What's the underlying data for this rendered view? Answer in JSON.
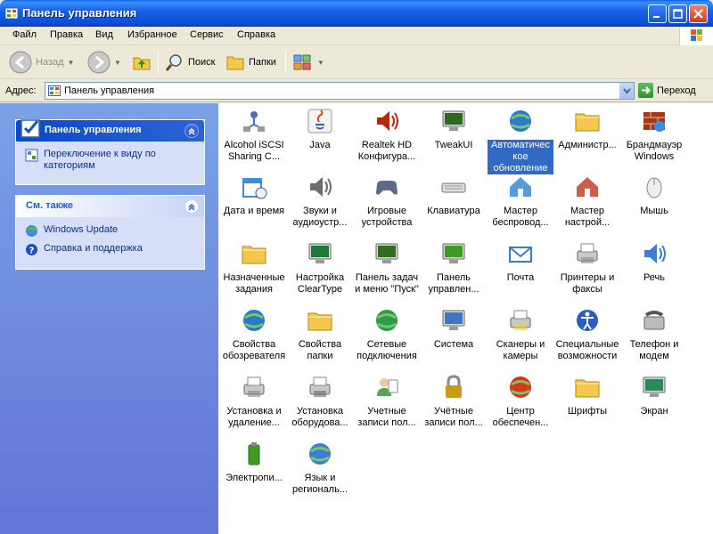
{
  "window": {
    "title": "Панель управления"
  },
  "menu": [
    "Файл",
    "Правка",
    "Вид",
    "Избранное",
    "Сервис",
    "Справка"
  ],
  "toolbar": {
    "back": "Назад",
    "search": "Поиск",
    "folders": "Папки"
  },
  "address": {
    "label": "Адрес:",
    "value": "Панель управления",
    "go": "Переход"
  },
  "taskpane": {
    "control_panel": {
      "title": "Панель управления",
      "link": "Переключение к виду по категориям"
    },
    "see_also": {
      "title": "См. также",
      "links": [
        "Windows Update",
        "Справка и поддержка"
      ]
    }
  },
  "icons": [
    {
      "l1": "Alcohol iSCSI",
      "l2": "Sharing C...",
      "icon": "network-icon",
      "color": "#4a6fb5"
    },
    {
      "l1": "Java",
      "l2": "",
      "icon": "java-icon",
      "color": "#d44a1e"
    },
    {
      "l1": "Realtek HD",
      "l2": "Конфигура...",
      "icon": "speaker-icon",
      "color": "#b32b0b"
    },
    {
      "l1": "TweakUI",
      "l2": "",
      "icon": "tweakui-icon",
      "color": "#2d6a1e"
    },
    {
      "l1": "Автоматичес",
      "l2": "кое",
      "l3": "обновление",
      "icon": "globe-icon",
      "color": "#2a7bd0",
      "selected": true
    },
    {
      "l1": "Администр...",
      "l2": "",
      "icon": "admin-folder-icon",
      "color": "#f2c94c"
    },
    {
      "l1": "Брандмауэр",
      "l2": "Windows",
      "icon": "firewall-icon",
      "color": "#a8361a"
    },
    {
      "l1": "Дата и время",
      "l2": "",
      "icon": "calendar-icon",
      "color": "#3d8ddc"
    },
    {
      "l1": "Звуки и",
      "l2": "аудиоустр...",
      "icon": "sound-icon",
      "color": "#6c6c6c"
    },
    {
      "l1": "Игровые",
      "l2": "устройства",
      "icon": "gamepad-icon",
      "color": "#5a6c8a"
    },
    {
      "l1": "Клавиатура",
      "l2": "",
      "icon": "keyboard-icon",
      "color": "#9a9a9a"
    },
    {
      "l1": "Мастер",
      "l2": "беспровод...",
      "icon": "wireless-icon",
      "color": "#3a8ad4"
    },
    {
      "l1": "Мастер",
      "l2": "настрой...",
      "icon": "house-icon",
      "color": "#c2432b"
    },
    {
      "l1": "Мышь",
      "l2": "",
      "icon": "mouse-icon",
      "color": "#b5b5b5"
    },
    {
      "l1": "Назначенные",
      "l2": "задания",
      "icon": "scheduled-folder-icon",
      "color": "#f2c94c"
    },
    {
      "l1": "Настройка",
      "l2": "ClearType",
      "icon": "cleartype-icon",
      "color": "#1c7a3b"
    },
    {
      "l1": "Панель задач",
      "l2": "и меню \"Пуск\"",
      "icon": "taskbar-icon",
      "color": "#2f6d1f"
    },
    {
      "l1": "Панель",
      "l2": "управлен...",
      "icon": "nvidia-icon",
      "color": "#3f9b26"
    },
    {
      "l1": "Почта",
      "l2": "",
      "icon": "mail-icon",
      "color": "#3d7bd1"
    },
    {
      "l1": "Принтеры и",
      "l2": "факсы",
      "icon": "printer-icon",
      "color": "#8a8a8a"
    },
    {
      "l1": "Речь",
      "l2": "",
      "icon": "speech-icon",
      "color": "#3a7fd1"
    },
    {
      "l1": "Свойства",
      "l2": "обозревателя",
      "icon": "ie-properties-icon",
      "color": "#2a79c9"
    },
    {
      "l1": "Свойства",
      "l2": "папки",
      "icon": "folder-options-icon",
      "color": "#f2c94c"
    },
    {
      "l1": "Сетевые",
      "l2": "подключения",
      "icon": "network-connections-icon",
      "color": "#2b9d4a"
    },
    {
      "l1": "Система",
      "l2": "",
      "icon": "system-icon",
      "color": "#3f74c7"
    },
    {
      "l1": "Сканеры и",
      "l2": "камеры",
      "icon": "scanner-icon",
      "color": "#f2c94c"
    },
    {
      "l1": "Специальные",
      "l2": "возможности",
      "icon": "accessibility-icon",
      "color": "#2a5ebc"
    },
    {
      "l1": "Телефон и",
      "l2": "модем",
      "icon": "phone-icon",
      "color": "#7a7a7a"
    },
    {
      "l1": "Установка и",
      "l2": "удаление...",
      "icon": "add-remove-icon",
      "color": "#8a8a8a"
    },
    {
      "l1": "Установка",
      "l2": "оборудова...",
      "icon": "hardware-icon",
      "color": "#6a6a6a"
    },
    {
      "l1": "Учетные",
      "l2": "записи пол...",
      "icon": "user-accounts-icon",
      "color": "#5aa25a"
    },
    {
      "l1": "Учётные",
      "l2": "записи пол...",
      "icon": "lock-icon",
      "color": "#c79a1a"
    },
    {
      "l1": "Центр",
      "l2": "обеспечен...",
      "icon": "security-shield-icon",
      "color": "#d23a1e"
    },
    {
      "l1": "Шрифты",
      "l2": "",
      "icon": "fonts-folder-icon",
      "color": "#f2c94c"
    },
    {
      "l1": "Экран",
      "l2": "",
      "icon": "display-icon",
      "color": "#2a8a5a"
    },
    {
      "l1": "Электропи...",
      "l2": "",
      "icon": "power-icon",
      "color": "#3f9b26"
    },
    {
      "l1": "Язык и",
      "l2": "региональ...",
      "icon": "regional-icon",
      "color": "#3a7fd1"
    }
  ]
}
